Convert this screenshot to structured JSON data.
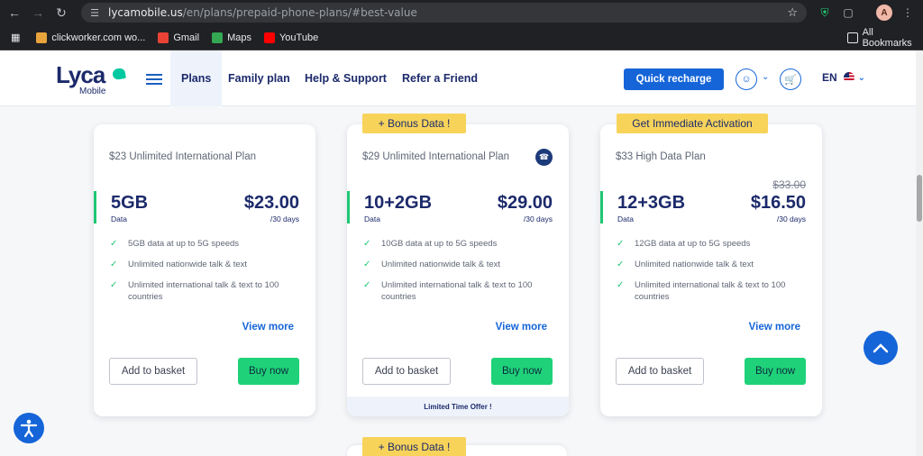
{
  "browser": {
    "url_host": "lycamobile.us",
    "url_path": "/en/plans/prepaid-phone-plans/#best-value",
    "profile_initial": "A",
    "bookmarks": [
      {
        "label": "clickworker.com wo...",
        "color": "#e8a33d"
      },
      {
        "label": "Gmail",
        "color": "#ea4335"
      },
      {
        "label": "Maps",
        "color": "#34a853"
      },
      {
        "label": "YouTube",
        "color": "#ff0000"
      }
    ],
    "all_bookmarks": "All Bookmarks"
  },
  "header": {
    "logo_main": "Lyca",
    "logo_sub": "Mobile",
    "nav": [
      "Plans",
      "Family plan",
      "Help & Support",
      "Refer a Friend"
    ],
    "quick_recharge": "Quick recharge",
    "language": "EN"
  },
  "plans": [
    {
      "name": "$23 Unlimited International Plan",
      "data": "5GB",
      "data_label": "Data",
      "price": "$23.00",
      "period": "/30 days",
      "features": [
        "5GB data at up to 5G speeds",
        "Unlimited nationwide talk & text",
        "Unlimited international talk & text to 100 countries"
      ],
      "view_more": "View more",
      "basket": "Add to basket",
      "buy": "Buy now"
    },
    {
      "ribbon": "+ Bonus Data !",
      "name": "$29 Unlimited International Plan",
      "data": "10+2GB",
      "data_label": "Data",
      "price": "$29.00",
      "period": "/30 days",
      "features": [
        "10GB data at up to 5G speeds",
        "Unlimited nationwide talk & text",
        "Unlimited international talk & text to 100 countries"
      ],
      "view_more": "View more",
      "basket": "Add to basket",
      "buy": "Buy now",
      "footer": "Limited Time Offer !"
    },
    {
      "ribbon": "Get Immediate Activation",
      "name": "$33 High Data Plan",
      "data": "12+3GB",
      "data_label": "Data",
      "old_price": "$33.00",
      "price": "$16.50",
      "period": "/30 days",
      "features": [
        "12GB data at up to 5G speeds",
        "Unlimited nationwide talk & text",
        "Unlimited international talk & text to 100 countries"
      ],
      "view_more": "View more",
      "basket": "Add to basket",
      "buy": "Buy now"
    }
  ],
  "next_ribbon": "+ Bonus Data !",
  "colors": {
    "brand": "#1c2a6b",
    "accent": "#1565d8",
    "buy": "#1fd279",
    "ribbon": "#f7d35a"
  }
}
